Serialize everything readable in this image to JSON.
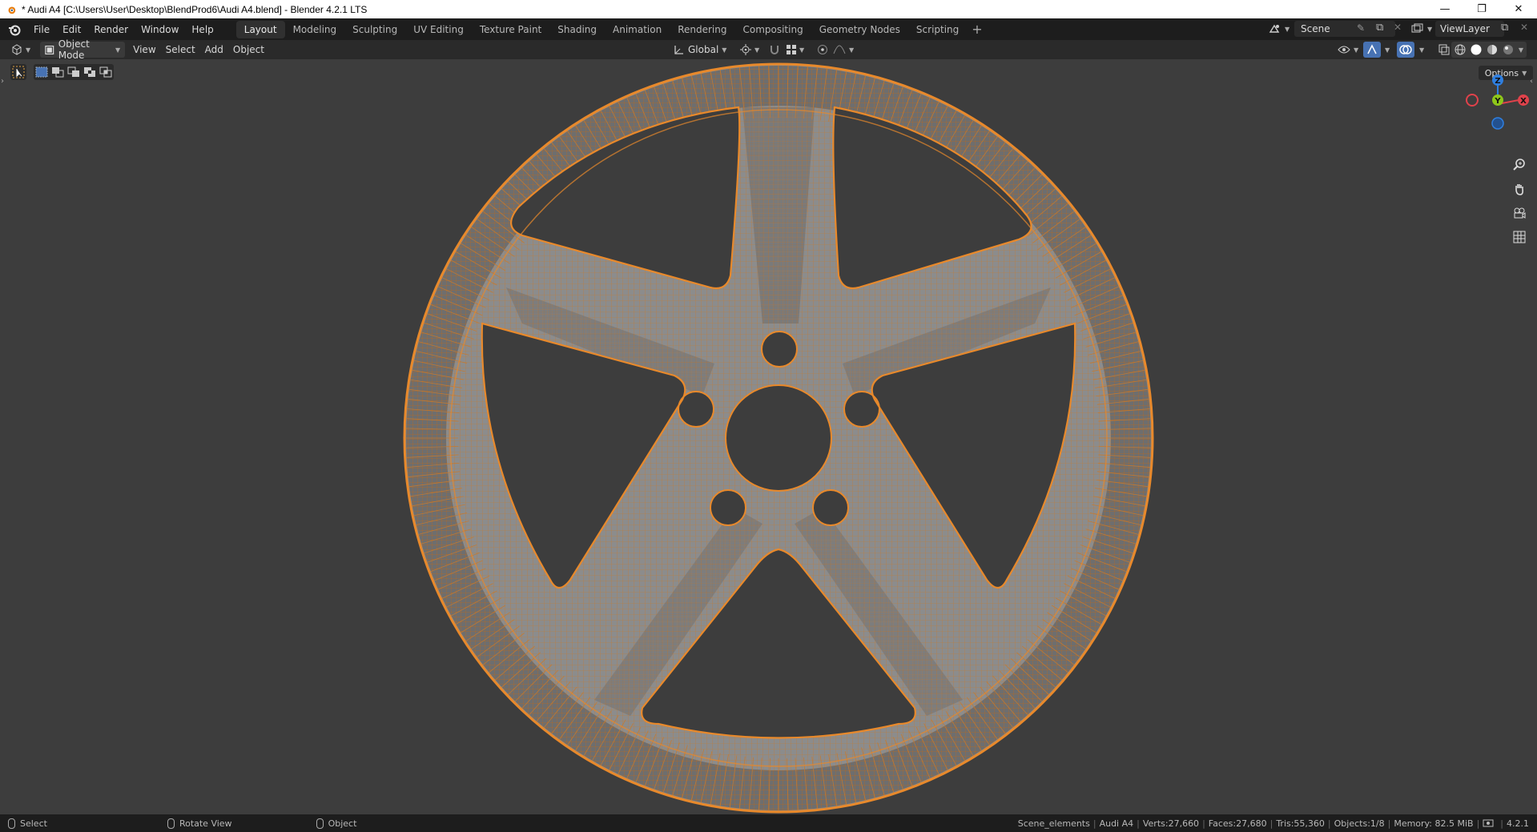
{
  "window": {
    "title": "* Audi A4 [C:\\Users\\User\\Desktop\\BlendProd6\\Audi A4.blend] - Blender 4.2.1 LTS",
    "controls": [
      "—",
      "❐",
      "✕"
    ]
  },
  "menu": [
    "File",
    "Edit",
    "Render",
    "Window",
    "Help"
  ],
  "workspaces": [
    "Layout",
    "Modeling",
    "Sculpting",
    "UV Editing",
    "Texture Paint",
    "Shading",
    "Animation",
    "Rendering",
    "Compositing",
    "Geometry Nodes",
    "Scripting"
  ],
  "active_workspace": "Layout",
  "add_workspace": "+",
  "scene": {
    "name": "Scene",
    "view_layer": "ViewLayer"
  },
  "viewport_header": {
    "mode": "Object Mode",
    "menus": [
      "View",
      "Select",
      "Add",
      "Object"
    ],
    "transform_orientation": "Global",
    "options_label": "Options"
  },
  "gizmo": {
    "x": "X",
    "y": "Y",
    "z": "Z"
  },
  "status": {
    "hints": [
      "Select",
      "Rotate View",
      "Object"
    ],
    "stats": [
      "Scene_elements",
      "Audi A4",
      "Verts:27,660",
      "Faces:27,680",
      "Tris:55,360",
      "Objects:1/8",
      "Memory: 82.5 MiB"
    ],
    "version": "4.2.1"
  },
  "colors": {
    "selection_wire": "#e8892b",
    "mesh_surface": "#8a8a8a",
    "viewport_bg": "#3d3d3d",
    "axis_x": "#e0424b",
    "axis_y": "#8ec71a",
    "axis_z": "#2f7fe0"
  }
}
